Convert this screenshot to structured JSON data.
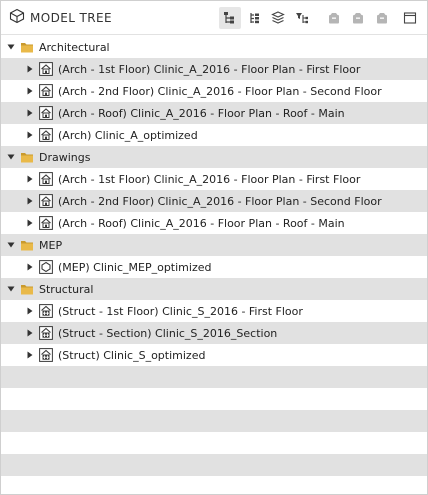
{
  "header": {
    "title": "MODEL TREE",
    "toolbar": [
      {
        "name": "tree-view-button",
        "icon": "tree-hierarchy-icon",
        "active": true
      },
      {
        "name": "list-view-button",
        "icon": "list-tree-icon",
        "active": false
      },
      {
        "name": "layers-view-button",
        "icon": "layers-icon",
        "active": false
      },
      {
        "name": "filter-tree-button",
        "icon": "filter-tree-icon",
        "active": false
      },
      {
        "name": "object-set-1-button",
        "icon": "cube-icon",
        "active": false
      },
      {
        "name": "object-set-2-button",
        "icon": "cube-icon",
        "active": false
      },
      {
        "name": "object-set-3-button",
        "icon": "cube-icon",
        "active": false
      },
      {
        "name": "window-button",
        "icon": "window-icon",
        "active": false
      }
    ]
  },
  "tree": [
    {
      "type": "folder",
      "label": "Architectural",
      "expanded": true
    },
    {
      "type": "model",
      "label": "(Arch - 1st Floor) Clinic_A_2016 - Floor Plan - First Floor",
      "icon": "building-icon"
    },
    {
      "type": "model",
      "label": "(Arch - 2nd Floor) Clinic_A_2016 - Floor Plan - Second Floor",
      "icon": "building-icon"
    },
    {
      "type": "model",
      "label": "(Arch - Roof) Clinic_A_2016 - Floor Plan - Roof - Main",
      "icon": "building-icon"
    },
    {
      "type": "model",
      "label": "(Arch) Clinic_A_optimized",
      "icon": "building-icon"
    },
    {
      "type": "folder",
      "label": "Drawings",
      "expanded": true
    },
    {
      "type": "model",
      "label": "(Arch - 1st Floor) Clinic_A_2016 - Floor Plan - First Floor",
      "icon": "building-icon"
    },
    {
      "type": "model",
      "label": "(Arch - 2nd Floor) Clinic_A_2016 - Floor Plan - Second Floor",
      "icon": "building-icon"
    },
    {
      "type": "model",
      "label": "(Arch - Roof) Clinic_A_2016 - Floor Plan - Roof - Main",
      "icon": "building-icon"
    },
    {
      "type": "folder",
      "label": "MEP",
      "expanded": true
    },
    {
      "type": "model",
      "label": "(MEP) Clinic_MEP_optimized",
      "icon": "mep-icon"
    },
    {
      "type": "folder",
      "label": "Structural",
      "expanded": true
    },
    {
      "type": "model",
      "label": "(Struct - 1st Floor) Clinic_S_2016 - First Floor",
      "icon": "structure-icon"
    },
    {
      "type": "model",
      "label": "(Struct - Section) Clinic_S_2016_Section",
      "icon": "structure-icon"
    },
    {
      "type": "model",
      "label": "(Struct) Clinic_S_optimized",
      "icon": "structure-icon"
    }
  ],
  "colors": {
    "folder": "#e9b949",
    "folder_dark": "#c99a2e",
    "model_icon": "#3a3a3a",
    "row_alt": "#e1e1e1"
  }
}
